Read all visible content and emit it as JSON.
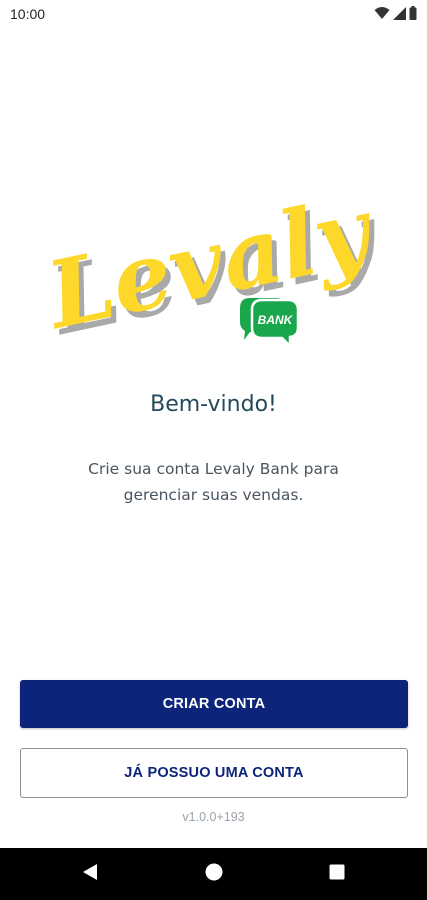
{
  "status_bar": {
    "time": "10:00",
    "icons": [
      "wifi-icon",
      "signal-icon",
      "battery-icon"
    ]
  },
  "logo": {
    "wordmark": "Levaly",
    "badge": "BANK",
    "colors": {
      "wordmark": "#fdd72a",
      "wordmark_shadow": "#9e9e9e",
      "badge_green": "#1aa64a"
    }
  },
  "welcome": {
    "title": "Bem-vindo!",
    "subtitle": "Crie sua conta Levaly Bank para gerenciar suas vendas."
  },
  "actions": {
    "create_account": "CRIAR CONTA",
    "have_account": "JÁ POSSUO UMA CONTA"
  },
  "version": "v1.0.0+193",
  "colors": {
    "primary": "#0c247a",
    "title": "#234a5a",
    "text": "#4a5560",
    "muted": "#9aa3ab"
  },
  "nav_bar": {
    "buttons": [
      "back-icon",
      "home-icon",
      "recents-icon"
    ]
  }
}
